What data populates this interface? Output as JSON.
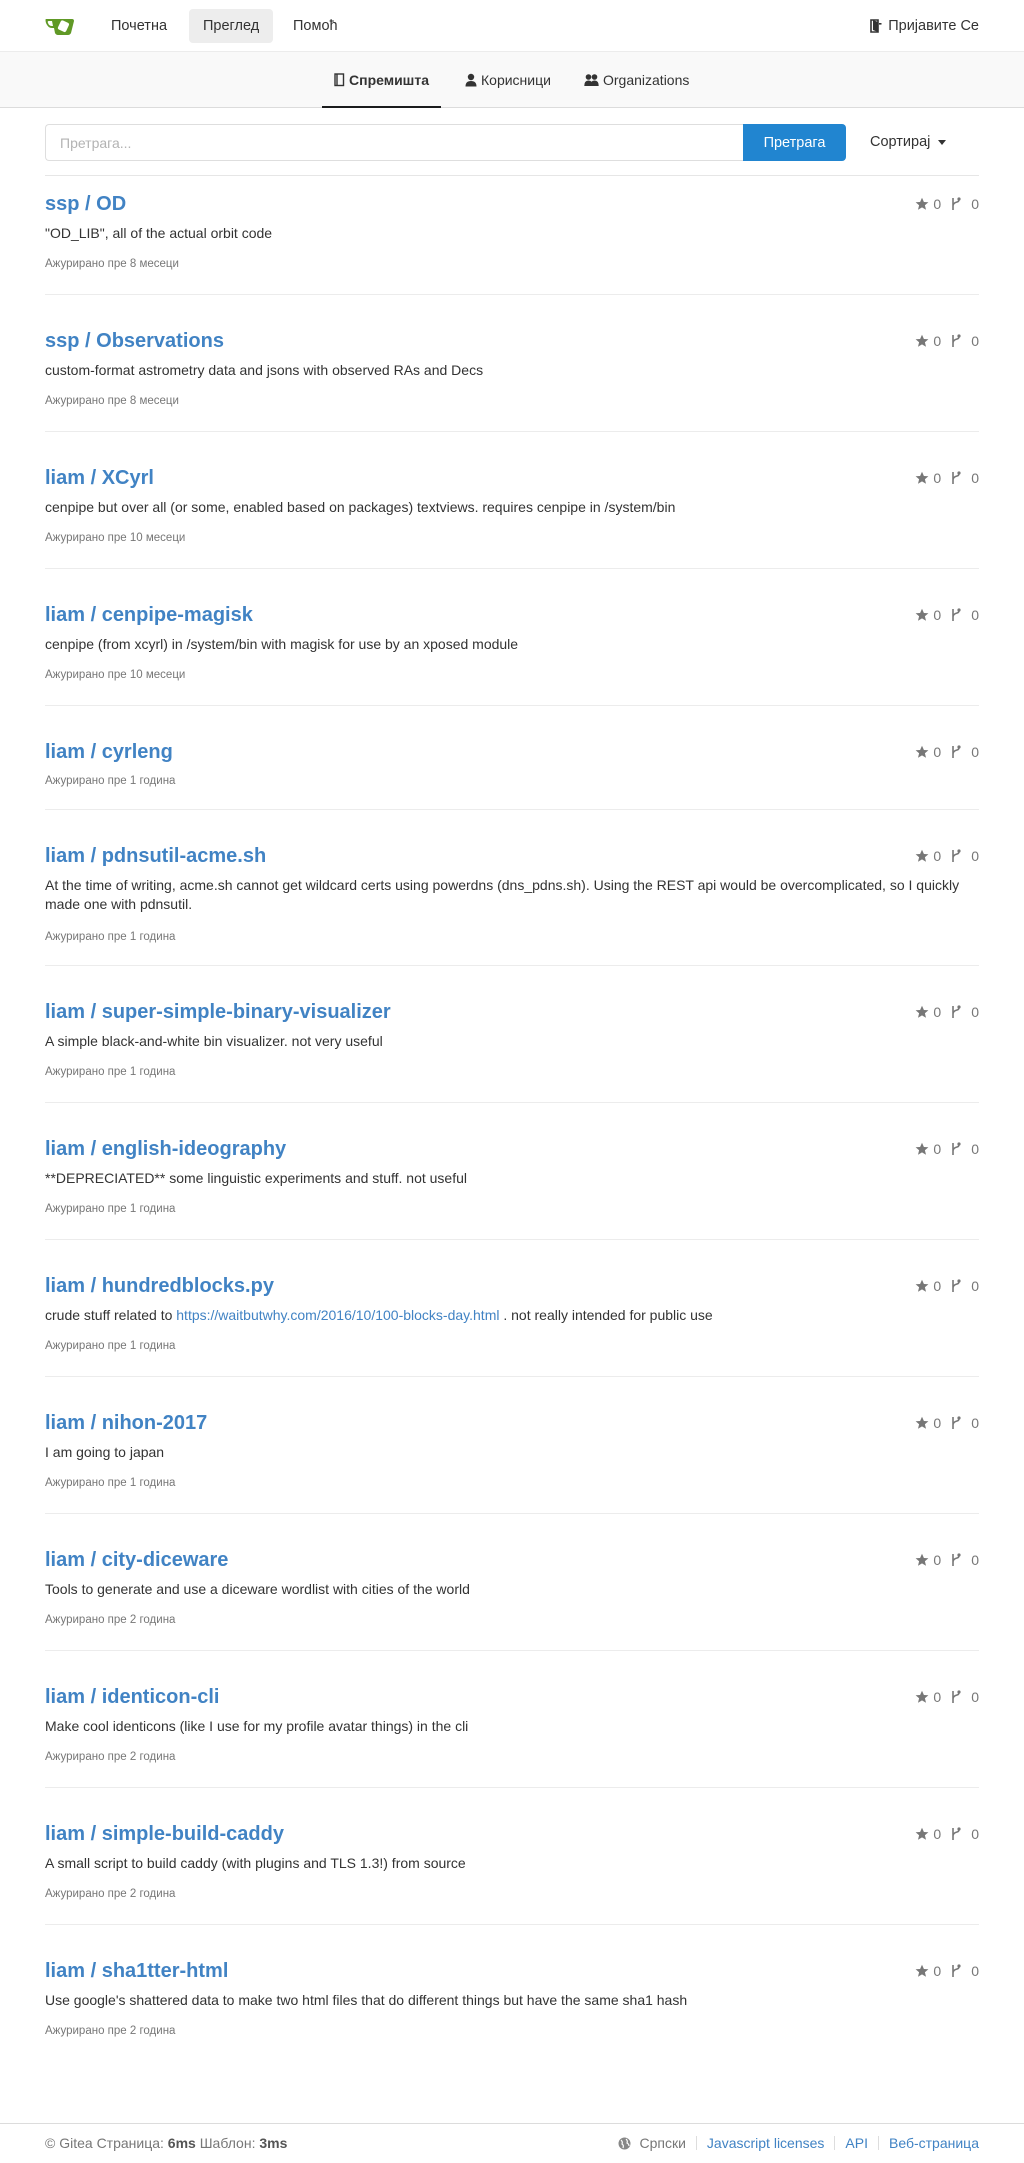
{
  "colors": {
    "accent": "#2185d0",
    "link": "#4183c4",
    "brand": "#609926"
  },
  "nav": {
    "home": "Почетна",
    "explore": "Преглед",
    "help": "Помоћ",
    "signin": "Пријавите Се"
  },
  "tabs": {
    "repos": "Спремишта",
    "users": "Корисници",
    "orgs": "Organizations"
  },
  "search": {
    "placeholder": "Претрага...",
    "button": "Претрага",
    "sort": "Сортирај"
  },
  "repos": [
    {
      "title": "ssp / OD",
      "stars": "0",
      "forks": "0",
      "description": "\"OD_LIB\", all of the actual orbit code",
      "updated": "Ажурирано пре 8 месеци"
    },
    {
      "title": "ssp / Observations",
      "stars": "0",
      "forks": "0",
      "description": "custom-format astrometry data and jsons with observed RAs and Decs",
      "updated": "Ажурирано пре 8 месеци"
    },
    {
      "title": "liam / XCyrl",
      "stars": "0",
      "forks": "0",
      "description": "cenpipe but over all (or some, enabled based on packages) textviews. requires cenpipe in /system/bin",
      "updated": "Ажурирано пре 10 месеци"
    },
    {
      "title": "liam / cenpipe-magisk",
      "stars": "0",
      "forks": "0",
      "description": "cenpipe (from xcyrl) in /system/bin with magisk for use by an xposed module",
      "updated": "Ажурирано пре 10 месеци"
    },
    {
      "title": "liam / cyrleng",
      "stars": "0",
      "forks": "0",
      "description": "",
      "updated": "Ажурирано пре 1 година"
    },
    {
      "title": "liam / pdnsutil-acme.sh",
      "stars": "0",
      "forks": "0",
      "description": "At the time of writing, acme.sh cannot get wildcard certs using powerdns (dns_pdns.sh). Using the REST api would be overcomplicated, so I quickly made one with pdnsutil.",
      "updated": "Ажурирано пре 1 година"
    },
    {
      "title": "liam / super-simple-binary-visualizer",
      "stars": "0",
      "forks": "0",
      "description": "A simple black-and-white bin visualizer. not very useful",
      "updated": "Ажурирано пре 1 година"
    },
    {
      "title": "liam / english-ideography",
      "stars": "0",
      "forks": "0",
      "description": "**DEPRECIATED** some linguistic experiments and stuff. not useful",
      "updated": "Ажурирано пре 1 година"
    },
    {
      "title": "liam / hundredblocks.py",
      "stars": "0",
      "forks": "0",
      "description_pre": "crude stuff related to",
      "description_link": "https://waitbutwhy.com/2016/10/100-blocks-day.html",
      "description_post": ". not really intended for public use",
      "updated": "Ажурирано пре 1 година"
    },
    {
      "title": "liam / nihon-2017",
      "stars": "0",
      "forks": "0",
      "description": "I am going to japan",
      "updated": "Ажурирано пре 1 година"
    },
    {
      "title": "liam / city-diceware",
      "stars": "0",
      "forks": "0",
      "description": "Tools to generate and use a diceware wordlist with cities of the world",
      "updated": "Ажурирано пре 2 година"
    },
    {
      "title": "liam / identicon-cli",
      "stars": "0",
      "forks": "0",
      "description": "Make cool identicons (like I use for my profile avatar things) in the cli",
      "updated": "Ажурирано пре 2 година"
    },
    {
      "title": "liam / simple-build-caddy",
      "stars": "0",
      "forks": "0",
      "description": "A small script to build caddy (with plugins and TLS 1.3!) from source",
      "updated": "Ажурирано пре 2 година"
    },
    {
      "title": "liam / sha1tter-html",
      "stars": "0",
      "forks": "0",
      "description": "Use google's shattered data to make two html files that do different things but have the same sha1 hash",
      "updated": "Ажурирано пре 2 година"
    }
  ],
  "footer": {
    "powered": "© Gitea",
    "page_label": "Страница:",
    "page_time": "6ms",
    "template_label": "Шаблон:",
    "template_time": "3ms",
    "language": "Српски",
    "licenses": "Javascript licenses",
    "api": "API",
    "website": "Веб-страница"
  }
}
